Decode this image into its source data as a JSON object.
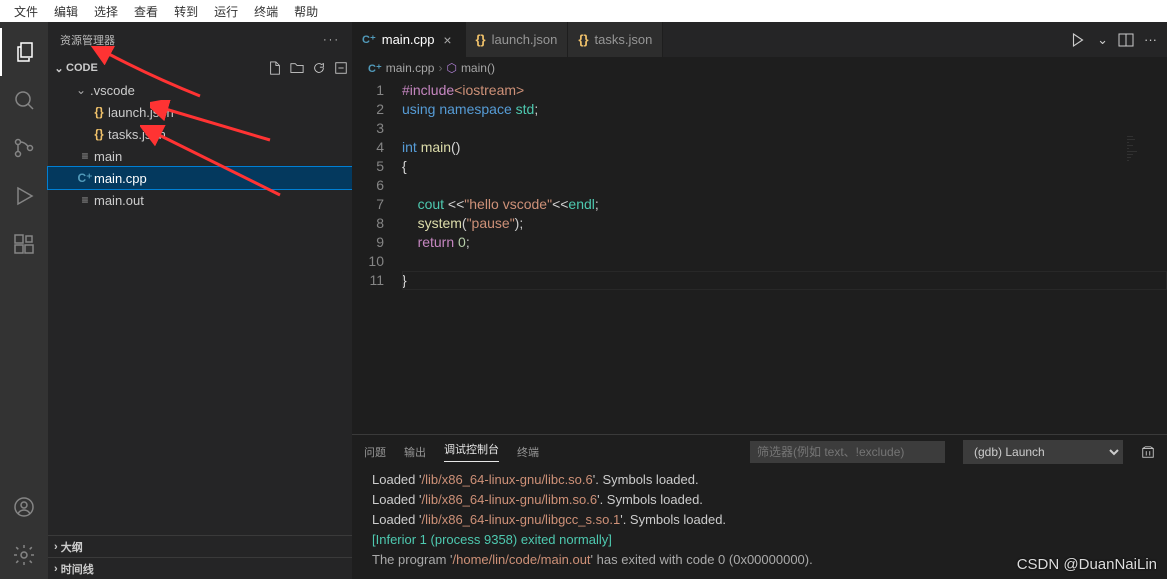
{
  "menubar": [
    "文件",
    "编辑",
    "选择",
    "查看",
    "转到",
    "运行",
    "终端",
    "帮助"
  ],
  "sidebar": {
    "title": "资源管理器",
    "root": "CODE",
    "outline": "大纲",
    "timeline": "时间线",
    "tree": [
      {
        "name": ".vscode",
        "kind": "folder",
        "depth": 1
      },
      {
        "name": "launch.json",
        "kind": "json",
        "depth": 2
      },
      {
        "name": "tasks.json",
        "kind": "json",
        "depth": 2
      },
      {
        "name": "main",
        "kind": "txt",
        "depth": 1
      },
      {
        "name": "main.cpp",
        "kind": "cpp",
        "depth": 1,
        "selected": true
      },
      {
        "name": "main.out",
        "kind": "txt",
        "depth": 1
      }
    ]
  },
  "tabs": [
    {
      "label": "main.cpp",
      "kind": "cpp",
      "active": true,
      "close": true
    },
    {
      "label": "launch.json",
      "kind": "json"
    },
    {
      "label": "tasks.json",
      "kind": "json"
    }
  ],
  "crumbs": {
    "file": "main.cpp",
    "symbol": "main()"
  },
  "code": {
    "lines": [
      {
        "n": 1,
        "html": "<span class='t-pre'>#include</span><span class='t-str'>&lt;iostream&gt;</span>"
      },
      {
        "n": 2,
        "html": "<span class='t-kw'>using</span> <span class='t-kw'>namespace</span> <span class='t-ns'>std</span>;"
      },
      {
        "n": 3,
        "html": ""
      },
      {
        "n": 4,
        "html": "<span class='t-kw'>int</span> <span class='t-fn'>main</span><span class='t-op'>()</span>"
      },
      {
        "n": 5,
        "html": "<span class='t-op'>{</span>"
      },
      {
        "n": 6,
        "html": ""
      },
      {
        "n": 7,
        "html": "    <span class='t-ns'>cout</span> <span class='t-op'>&lt;&lt;</span><span class='t-str'>\"hello vscode\"</span><span class='t-op'>&lt;&lt;</span><span class='t-ns'>endl</span>;"
      },
      {
        "n": 8,
        "html": "    <span class='t-fn'>system</span>(<span class='t-str'>\"pause\"</span>);"
      },
      {
        "n": 9,
        "html": "    <span class='t-pre'>return</span> <span class='t-num'>0</span>;"
      },
      {
        "n": 10,
        "html": ""
      },
      {
        "n": 11,
        "html": "<span class='t-op'>}</span>"
      }
    ],
    "current_line": 11
  },
  "panel": {
    "tabs": [
      "问题",
      "输出",
      "调试控制台",
      "终端"
    ],
    "active": 2,
    "filter_placeholder": "筛选器(例如 text、!exclude)",
    "launch_config": "(gdb) Launch",
    "lines": [
      {
        "pre": "Loaded '",
        "path": "/lib/x86_64-linux-gnu/libc.so.6",
        "post": "'. Symbols loaded."
      },
      {
        "pre": "Loaded '",
        "path": "/lib/x86_64-linux-gnu/libm.so.6",
        "post": "'. Symbols loaded."
      },
      {
        "pre": "Loaded '",
        "path": "/lib/x86_64-linux-gnu/libgcc_s.so.1",
        "post": "'. Symbols loaded."
      },
      {
        "info": "[Inferior 1 (process 9358) exited normally]"
      },
      {
        "exit_pre": "The program '",
        "exit_path": "/home/lin/code/main.out",
        "exit_post": "' has exited with code 0 (0x00000000)."
      }
    ]
  },
  "watermark": "CSDN @DuanNaiLin"
}
